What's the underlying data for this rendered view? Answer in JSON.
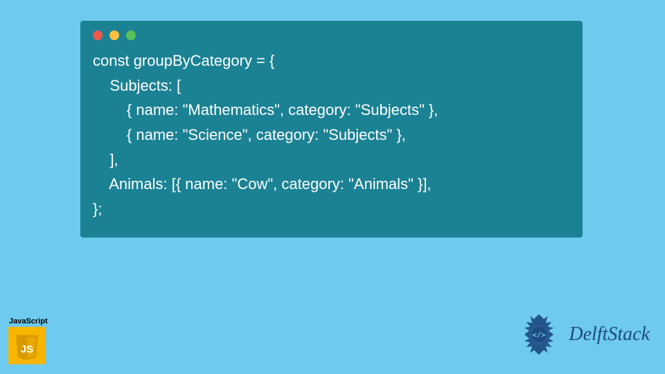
{
  "codeWindow": {
    "dots": [
      "red",
      "yellow",
      "green"
    ],
    "lines": [
      "const groupByCategory = {",
      "    Subjects: [",
      "        { name: \"Mathematics\", category: \"Subjects\" },",
      "        { name: \"Science\", category: \"Subjects\" },",
      "    ],",
      "    Animals: [{ name: \"Cow\", category: \"Animals\" }],",
      "};"
    ]
  },
  "jsBadge": {
    "label": "JavaScript",
    "glyph": "JS"
  },
  "delftStack": {
    "text": "DelftStack"
  }
}
